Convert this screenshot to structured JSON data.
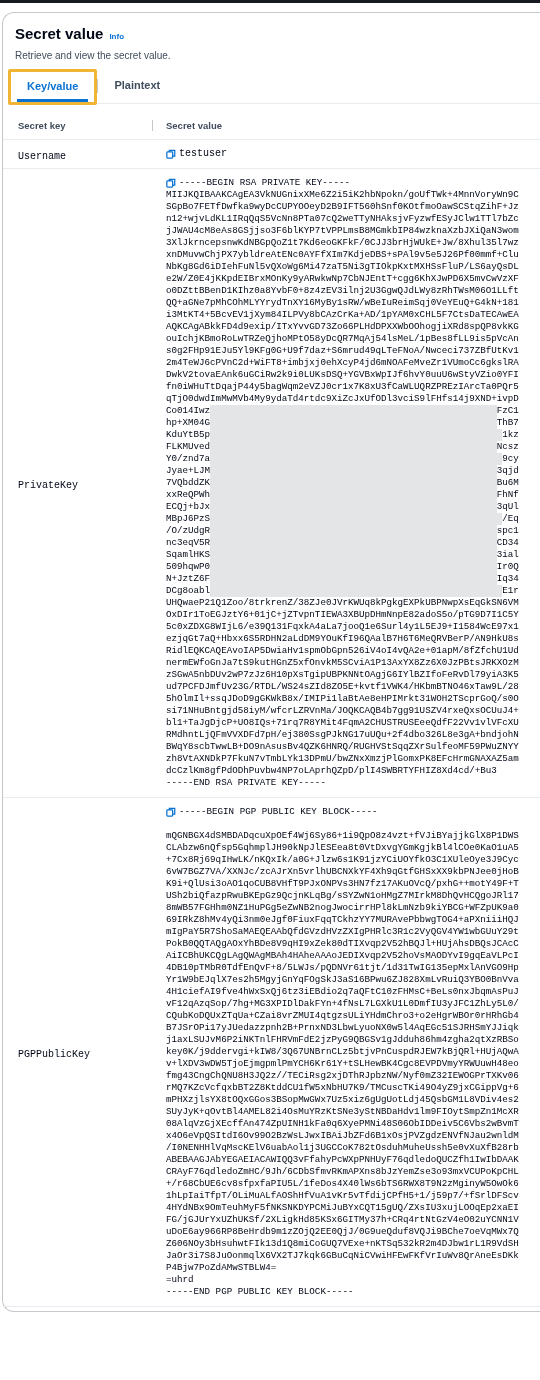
{
  "panel": {
    "title": "Secret value",
    "info_link": "Info",
    "description": "Retrieve and view the secret value."
  },
  "tabs": [
    {
      "label": "Key/value",
      "selected": true,
      "highlighted": true
    },
    {
      "label": "Plaintext",
      "selected": false,
      "highlighted": false
    }
  ],
  "table": {
    "columns": [
      "Secret key",
      "Secret value"
    ],
    "rows": [
      {
        "kind": "single",
        "key": "Username",
        "value": "testuser"
      },
      {
        "kind": "block",
        "key": "PrivateKey",
        "header": "-----BEGIN RSA PRIVATE KEY-----",
        "footer": "-----END RSA PRIVATE KEY-----",
        "lines": [
          {
            "kind": "text",
            "text": "MIIJKQIBAAKCAgEA3VkNUGnixXMe6Z2i5iK2hbNpokn/goUfTWk+4MnnVoryWn9C"
          },
          {
            "kind": "text",
            "text": "SGpBo7FETfDwfka9wyDcCUPYOOeyD2B9IFT560hSnf0KOtfmoOawSCStqZihF+Jz"
          },
          {
            "kind": "text",
            "text": "n12+wjvLdKL1IRqQqS5VcNn8PTa07cQ2weTTyNHAksjvFyzwfESyJClw1TTl7bZc"
          },
          {
            "kind": "text",
            "text": "jJWAU4cM8eAs8GSjjso3F6blKYP7tVPPLmsB8MGmkbIP84wzknaXzbJXiQaN3wom"
          },
          {
            "kind": "text",
            "text": "3XlJkrncepsnwKdNBGpQoZ1t7Kd6eoGKFkF/0CJJ3brHjWUkE+Jw/8Xhul35l7wz"
          },
          {
            "kind": "text",
            "text": "xnDMuvwChjPX7ybldreAtENc0AYFfXIm7KdjeDBS+sPAl9v5e5J26Pf00mmf+Clu"
          },
          {
            "kind": "text",
            "text": "NbKg8Gd6iDIehFuNl5vQXoWg6Mi47zaT5Ni3gTIOkpKxtMXHSsFluP/LS6ayQsDL"
          },
          {
            "kind": "text",
            "text": "e2W/Z0E4jKKpdEIBrxMOnKy9yARwkwNp7CbNJEntT+cgg6KhXJwPD6X5mvCwVzXF"
          },
          {
            "kind": "text",
            "text": "o0DZttBBenD1KIhz0a8YvbF0+8z4zEV3ilnj2U3GgwQJdLWy8zRhTWsM06O1LLft"
          },
          {
            "kind": "text",
            "text": "QQ+aGNe7pMhCOhMLYYrydTnXY16MyBy1sRW/wBeIuReimSqj0VeYEuQ+G4kN+181"
          },
          {
            "kind": "text",
            "text": "i3MtKT4+5BcvEV1jXym84ILPVy8bCAzCrKa+AD/1pYAM0xCHL5F7CtsDaTECAwEA"
          },
          {
            "kind": "text",
            "text": "AQKCAgABkkFD4d9exip/ITxYvvGD73Zo66PLHdDPXXWbOOhogjiXRd8spQP8vkKG"
          },
          {
            "kind": "text",
            "text": "ouIchjKBmoRoLwTRZeQjhoMPtO58yDcQR7MqAj54lsMeL/1pBes8fLL9is5pVcAn"
          },
          {
            "kind": "text",
            "text": "s0g2FHp91EJu5Yl9KFg0G+U9f7daz+S6mrud49qLTeFNoA/Nwceci737ZBfUtKv1"
          },
          {
            "kind": "text",
            "text": "2m4TeWJ6cPVnC2d+WiFT8+imbjxj0ehXcyP4jd6mNOAFeMveZr1VUmoCc6gkslRA"
          },
          {
            "kind": "text",
            "text": "DwkV2tovaEAnk6uGCiRw2k9i0LUKsDSQ+YGVBxWpIJf6hvY0uuU6wStyVZio0YFI"
          },
          {
            "kind": "text",
            "text": "fn0iWHuTtDqajP44y5bagWqm2eVZJ0cr1x7K8xU3fCaWLUQRZPREzIArcTa0PQr5"
          },
          {
            "kind": "text",
            "text": "qTjO0dwdImMwMVb4My9ydaTd4rtdc9XiZcJxUfODl3vciS9lFHfs14j9XND+ivpD"
          },
          {
            "kind": "redacted",
            "start": "Co014Iwz",
            "end": "FzC1"
          },
          {
            "kind": "redacted",
            "start": "hp+XM04G",
            "end": "ThB7"
          },
          {
            "kind": "redacted",
            "start": "KduYtB5p",
            "end": "1kz"
          },
          {
            "kind": "redacted",
            "start": "FLKMUved",
            "end": "Ncsz"
          },
          {
            "kind": "redacted",
            "start": "Y0/znd7a",
            "end": "9cy"
          },
          {
            "kind": "redacted",
            "start": "Jyae+LJM",
            "end": "3qjd"
          },
          {
            "kind": "redacted",
            "start": "7VQbddZK",
            "end": "Bu6M"
          },
          {
            "kind": "redacted",
            "start": "xxReQPWh",
            "end": "FhNf"
          },
          {
            "kind": "redacted",
            "start": "ECQj+bJx",
            "end": "3qUl"
          },
          {
            "kind": "redacted",
            "start": "MBpJ6PzS",
            "end": "/Eq"
          },
          {
            "kind": "redacted",
            "start": "/O/zUdgR",
            "end": "spc1"
          },
          {
            "kind": "redacted",
            "start": "nc3eqV5R",
            "end": "CD34"
          },
          {
            "kind": "redacted",
            "start": "SqamlHKS",
            "end": "3ial"
          },
          {
            "kind": "redacted",
            "start": "509hqwP0",
            "end": "Ir0Q"
          },
          {
            "kind": "redacted",
            "start": "N+JztZ6F",
            "end": "Iq34"
          },
          {
            "kind": "redacted",
            "start": "DCg8oabl",
            "end": "E1r"
          },
          {
            "kind": "text",
            "text": "UHQwaeP21Q1Zoo/8trkrenZ/38ZJe0JVrKWUq8kPgkgEXPkUBPNwpXsEqGkSN6VM"
          },
          {
            "kind": "text",
            "text": "OxDIr1ToEGJztY6+01jC+jZTvpnTIEWA3XBUpDHmNnpE82adoS5o/pTG9D7I1C5Y"
          },
          {
            "kind": "text",
            "text": "5c0xZDXG8WIjL6/e39Q131FqxkA4aLa7jooQ1e6Surl4y1L5EJ9+I1584WcE97x1"
          },
          {
            "kind": "text",
            "text": "ezjqGt7aQ+Hbxx6S5RDHN2aLdDM9YOuKfI96QAalB7H6T6MeQRVBerP/AN9HkU8s"
          },
          {
            "kind": "text",
            "text": "RidlEQKCAQEAvoIAP5DwiaHv1spmObGpn526iV4oI4vQA2e+01apM/8fZfchU1Ud"
          },
          {
            "kind": "text",
            "text": "nermEWfoGnJa7tS9kutHGnZ5xfOnvkM5SCviA1P13AxYX8Zz6X0JzPBtsJRKXOzM"
          },
          {
            "kind": "text",
            "text": "zSGwA5nbDUv2wP7zJz6H10pXsTgipUBPKNNtOAgjG6IYlBZIfoFeRvDl79yiA3K5"
          },
          {
            "kind": "text",
            "text": "ud7PCFDJmfUv23G/RTDL/WS24sZId8ZO5E+kvtf1VWK4/HKbmBTNO46xTaw9L/28"
          },
          {
            "kind": "text",
            "text": "5hOlmIl+ssqJDoD9gGKWkB8x/IMIPi1laBtAe8eHPIMrkt31WOH2TScprGoQ/s0O"
          },
          {
            "kind": "text",
            "text": "si71NHuBntgjd58iyM/wfcrLZRVnMa/JOQKCAQB4b7gg91USZV4rxeQxsOCUuJ4+"
          },
          {
            "kind": "text",
            "text": "bl1+TaJgDjcP+UO8IQs+71rq7R8YMit4FqmA2CHUSTRUSEeeQdfF22Vv1vlVFcXU"
          },
          {
            "kind": "text",
            "text": "RMdhntLjQFmVVXDFd7pH/ej380SsgPJkNG17uUQu+2f4dbo326L8e3gA+bndjohN"
          },
          {
            "kind": "text",
            "text": "BWqY8scbTwwLB+DO9nAsusBv4QZK6HNRQ/RUGHVStSqqZXrSulfeoMF59PWuZNYY"
          },
          {
            "kind": "text",
            "text": "zh8VtAXNDkP7FkuN7vTmbLYk13DPmU/bwZNxXmzjPlGomxPK8EFcHrmGNAXAZ5am"
          },
          {
            "kind": "text",
            "text": "dcCzlKm8gfPdODhPuvbw4NP7oLAprhQZpD/plI4SWBRTYFHIZ8Xd4cd/+Bu3"
          }
        ]
      },
      {
        "kind": "block",
        "key": "PGPPublicKey",
        "header": "-----BEGIN PGP PUBLIC KEY BLOCK-----",
        "footer": "-----END PGP PUBLIC KEY BLOCK-----",
        "lines": [
          {
            "kind": "blank"
          },
          {
            "kind": "text",
            "text": "mQGNBGX4dSMBDADqcuXpOEf4Wj6Sy86+1i9QpO8z4vzt+fVJiBYajjkGlX8P1DWS"
          },
          {
            "kind": "text",
            "text": "CLAbzw6nQfsp5GqhmplJH90kNpJlESEea8t0VtDxvgYGmKgjkBl4lCOe0KaO1uA5"
          },
          {
            "kind": "text",
            "text": "+7Cx8Rj69qIHwLK/nKQxIk/a0G+Jlzw6s1K91jzYCiUOYfkO3C1XUleOye3J9Cyc"
          },
          {
            "kind": "text",
            "text": "6vW7BGZ7VA/XXNJc/zcAJrXn5vrlhUBCNXkYF4Xh9qGtfGHSxXX9kbPNJee0jHoB"
          },
          {
            "kind": "text",
            "text": "K9i+QlUsi3oAO1qoCUB8VHfT9PJxONPVs3HN7fz17AKuOVcQ/pxhG++motY49F+T"
          },
          {
            "kind": "text",
            "text": "USh2biQfazpRwuBKEpGz9QcjnKLqBg/sSYZwN1oHMgZ7MIrkM8DhQvHCQgoJRl17"
          },
          {
            "kind": "text",
            "text": "8mWB57FGHhm0NZ1HuPGg5eZwNB2nogJwocirrHPl8kLmNzb9kiYBCG+WFZpUK9a0"
          },
          {
            "kind": "text",
            "text": "69IRkZ8hMv4yQi3nm0eJgf0FiuxFqqTCkhzYY7MURAvePbbwgTOG4+aPXniiiHQJ"
          },
          {
            "kind": "text",
            "text": "mIgPaY5R7ShoSaMAEQEAAbQfdGVzdHVzZXIgPHRlc3R1c2VyQGV4YW1wbGUuY29t"
          },
          {
            "kind": "text",
            "text": "PokB0QQTAQgAOxYhBDe8V9qHI9xZek80dTIXvqp2V52hBQJl+HUjAhsDBQsJCAcC"
          },
          {
            "kind": "text",
            "text": "AiICBhUKCQgLAgQWAgMBAh4HAheAAAoJEDIXvqp2V52hoVsMAODYvI9gqEaVLPcI"
          },
          {
            "kind": "text",
            "text": "4DB10pTMbR0TdfEnQvF+8/5LWJs/pQDNVr61tjt/1d31TwIG135epMxlAnVGO9Hp"
          },
          {
            "kind": "text",
            "text": "Yr1W9bEJqlX7es2h5MgyjGnYqFOgSkJ3aS16BPwu6ZJ828XmLvRuiQ3YBO0BnVva"
          },
          {
            "kind": "text",
            "text": "4H1ciefAI9fve4hWxSxQj6tz3iEBdio2q7aQFtC10zFHMsC+BeLs0nxJbqmAsPuJ"
          },
          {
            "kind": "text",
            "text": "vF12qAzqSop/7hg+MG3XPIDlDakFYn+4fNsL7LGXkU1L0DmfIU3yJFC1ZhLy5L0/"
          },
          {
            "kind": "text",
            "text": "CQubKoDQUxZTqUa+CZai8vrZMUI4qtgzsULiYHdmChro3+o2eHgrWBOr0rHRhGb4"
          },
          {
            "kind": "text",
            "text": "B7JSrOPi17yJUedazzpnh2B+PrnxND3LbwLyuoNX0w5l4AqEGc51SJRHSmYJJiqk"
          },
          {
            "kind": "text",
            "text": "j1axLSUJvM6P2iNKTnlFHRVmFdE2jzPyG9QBGSv1gJdduh86hm4zgha2qtXzRBSo"
          },
          {
            "kind": "text",
            "text": "key0K/j9ddervgi+kIW8/3Q67UNBrnCLz5btjvPnCuspdRJEW7kBjQRl+HUjAQwA"
          },
          {
            "kind": "text",
            "text": "v+lXDV3wDW5TjoEjmgpmlPmYCH6Kr61Y+tSLHewBK4Cgc8EVPDVmyYRWUuwH48eo"
          },
          {
            "kind": "text",
            "text": "fmg43CngChQNU8H3JQ2z//TECiRsg2xjDThRJpbzNW/Nyf0mZ32IEWOGPrTXKv06"
          },
          {
            "kind": "text",
            "text": "rMQ7KZcVcfqxbBT2Z8KtddCU1fW5xNbHU7K9/TMCuscTKi49O4yZ9jxCGippVg+6"
          },
          {
            "kind": "text",
            "text": "mPHXzjlsYX8tOQxGGos3BSopMwGWx7Uz5xiz6gUgUotLdj45QsbGM1L8VDiv4es2"
          },
          {
            "kind": "text",
            "text": "SUyJyK+qOvtBl4AMEL82i4OsMuYRzKtSNe3yStNBDaHdv1lm9FIOytSmpZn1McXR"
          },
          {
            "kind": "text",
            "text": "08AlqVzGjXEcffAn474ZpUINH1kFa0q6XyePMNi48S06ObIDDeiv5C6Vbs2wBvmT"
          },
          {
            "kind": "text",
            "text": "x4O6eVpQSItdI6Ov99O2BzWsLJwxIBAiJbZFd6B1xOsjPVZgdzENVfNJau2wnldM"
          },
          {
            "kind": "text",
            "text": "/I0NENHHlVqMscKElV6uabAol1j3UGCCoK782tOsduhMuheUssh5e0vXuXfB28rb"
          },
          {
            "kind": "text",
            "text": "ABEBAAGJAbYEGAEIACAWIQQ3vFfahyPcWXpPNHUyF76qdledoQUCZfh1IwIbDAAK"
          },
          {
            "kind": "text",
            "text": "CRAyF76qdledoZmHC/9Jh/6CDbSfmvRKmAPXns8bJzYemZse3o93mxVCUPoKpCHL"
          },
          {
            "kind": "text",
            "text": "+/r68CbUE6cv8sfpxfaPIU5L/1feDos4X40lWs6bTS6RWX8T9N2zMginyW5OwOk6"
          },
          {
            "kind": "text",
            "text": "1hLpIaiTfpT/OLiMuALfAOShHfVuA1vKr5vTfdijCPfH5+1/j59p7/+fSrlDFScv"
          },
          {
            "kind": "text",
            "text": "4HYdNBx9OmTeuhMyF5fNKSNKDYPCMiJuBYxCQT15gUQ/ZXsIU3xujLOOqEp2xaEI"
          },
          {
            "kind": "text",
            "text": "FG/jGJUrYxUZhUKSf/2XLigkHd85KSx6GITMy37h+CRq4rtNtGzV4eO02uYCNN1V"
          },
          {
            "kind": "text",
            "text": "uDoE6ay966RP8BeHrdb9m1zZOjQ2EE0QjJ/0G9ueQduf8VQJi9BChe7oeVqMWx7Q"
          },
          {
            "kind": "text",
            "text": "Z606NOy3bHsuhwtFIk13d1Q8miCoGUQ7VExe+nKTSq532kR2m4DJbw1rL1R9VdSH"
          },
          {
            "kind": "text",
            "text": "JaOr3i7S8JuOonmqlX6VX2TJ7kqk6GBuCqNiCVwiHFEwFKfVrIuWv8QrAneEsDKk"
          },
          {
            "kind": "text",
            "text": "P4Bjw7PoZdAMwSTBLW4="
          },
          {
            "kind": "text",
            "text": "=uhrd"
          }
        ]
      }
    ]
  }
}
